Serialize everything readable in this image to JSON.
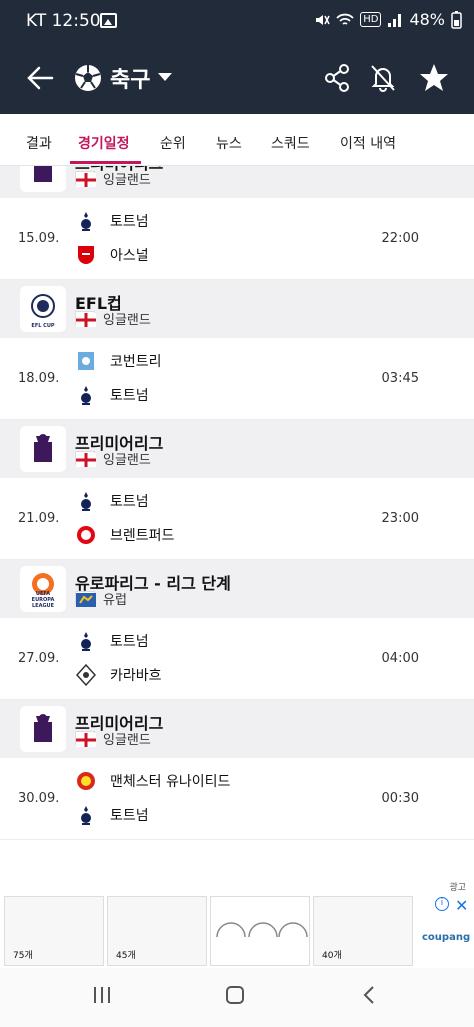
{
  "status": {
    "time": "KT 12:50",
    "battery": "48%",
    "hd": "HD"
  },
  "appbar": {
    "title": "축구"
  },
  "tabs": [
    "결과",
    "경기일정",
    "순위",
    "뉴스",
    "스쿼드",
    "이적 내역"
  ],
  "sections": [
    {
      "league": "프리미어리그",
      "country": "잉글랜드",
      "logo": "premier-league-logo",
      "match": {
        "date": "15.09.",
        "time": "22:00",
        "home": "토트넘",
        "away": "아스널"
      }
    },
    {
      "league": "EFL컵",
      "country": "잉글랜드",
      "logo": "efl-cup-logo",
      "logo_text": "EFL CUP",
      "match": {
        "date": "18.09.",
        "time": "03:45",
        "home": "코번트리",
        "away": "토트넘"
      }
    },
    {
      "league": "프리미어리그",
      "country": "잉글랜드",
      "logo": "premier-league-logo",
      "match": {
        "date": "21.09.",
        "time": "23:00",
        "home": "토트넘",
        "away": "브렌트퍼드"
      }
    },
    {
      "league": "유로파리그 - 리그 단계",
      "country": "유럽",
      "logo": "europa-league-logo",
      "logo_text": "UEFA EUROPA LEAGUE",
      "match": {
        "date": "27.09.",
        "time": "04:00",
        "home": "토트넘",
        "away": "카라바흐"
      }
    },
    {
      "league": "프리미어리그",
      "country": "잉글랜드",
      "logo": "premier-league-logo",
      "match": {
        "date": "30.09.",
        "time": "00:30",
        "home": "맨체스터 유나이티드",
        "away": "토트넘"
      }
    }
  ],
  "ad": {
    "label": "광고",
    "brand": "coupang",
    "counts": [
      "75개",
      "45개",
      "",
      "40개"
    ]
  },
  "colors": {
    "dark": "#222b3a",
    "accent": "#c2185b"
  }
}
